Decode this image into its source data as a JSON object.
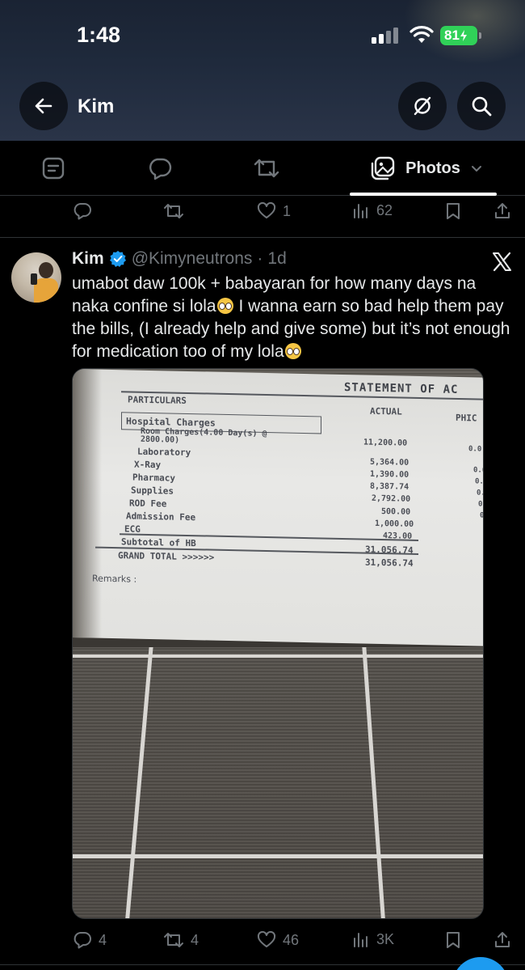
{
  "status_bar": {
    "time": "1:48",
    "battery": "81"
  },
  "header": {
    "title": "Kim"
  },
  "tabs": {
    "photos_label": "Photos"
  },
  "prev_tweet_actions": {
    "likes": "1",
    "views": "62"
  },
  "tweet": {
    "name": "Kim",
    "handle": "@Kimyneutrons",
    "dot": "·",
    "time": "1d",
    "text_1": "umabot daw 100k + babayaran for how many days na naka confine si lola",
    "text_2": " I wanna earn so bad help them pay the bills, (I already help and give some) but it’s not enough for medication too of my lola",
    "replies": "4",
    "reposts": "4",
    "likes": "46",
    "views": "3K"
  },
  "receipt": {
    "heading": "STATEMENT OF AC",
    "col_particulars": "PARTICULARS",
    "col_actual": "ACTUAL",
    "col_phic": "PHIC",
    "section": "Hospital Charges",
    "rows": [
      {
        "label": "Room Charges(4.00 Day(s) @",
        "value": ""
      },
      {
        "label": "2800.00)",
        "value": "11,200.00"
      },
      {
        "label": "Laboratory",
        "value": ""
      },
      {
        "label": "X-Ray",
        "value": "5,364.00"
      },
      {
        "label": "Pharmacy",
        "value": "1,390.00"
      },
      {
        "label": "",
        "value": "8,387.74"
      },
      {
        "label": "Supplies",
        "value": "2,792.00"
      },
      {
        "label": "ROD Fee",
        "value": "500.00"
      },
      {
        "label": "Admission Fee",
        "value": "1,000.00"
      },
      {
        "label": "ECG",
        "value": "423.00"
      }
    ],
    "subtotal_label": "Subtotal of HB",
    "subtotal_value": "31,056.74",
    "grand_label": "GRAND TOTAL >>>>>>",
    "grand_value": "31,056.74",
    "remarks": "Remarks :",
    "phic_values": [
      "0.0",
      "0.0",
      "0.",
      "0.",
      "0",
      "0"
    ]
  }
}
